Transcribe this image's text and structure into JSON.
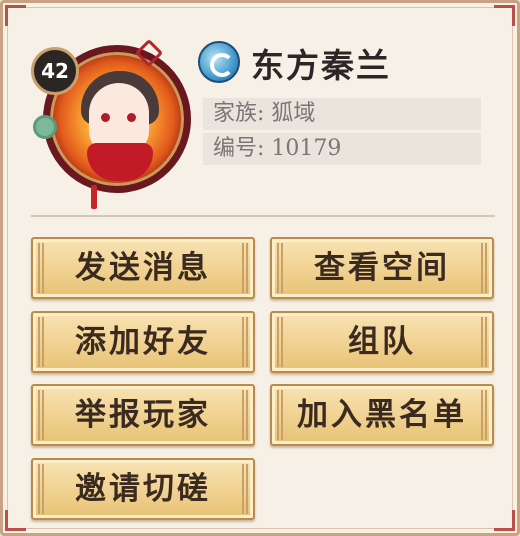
{
  "profile": {
    "level": "42",
    "name": "东方秦兰",
    "clan_label": "家族: 狐域",
    "id_label": "编号: 10179",
    "emblem_icon": "taichi-emblem-icon",
    "avatar_icon": "character-portrait"
  },
  "actions": {
    "send_message": "发送消息",
    "view_space": "查看空间",
    "add_friend": "添加好友",
    "team_up": "组队",
    "report_player": "举报玩家",
    "blacklist": "加入黑名单",
    "invite_duel": "邀请切磋"
  },
  "colors": {
    "panel_bg": "#f6f0e7",
    "button_gold": "#f2d496",
    "accent_red": "#b85048",
    "emblem_blue": "#4aa0d0"
  }
}
